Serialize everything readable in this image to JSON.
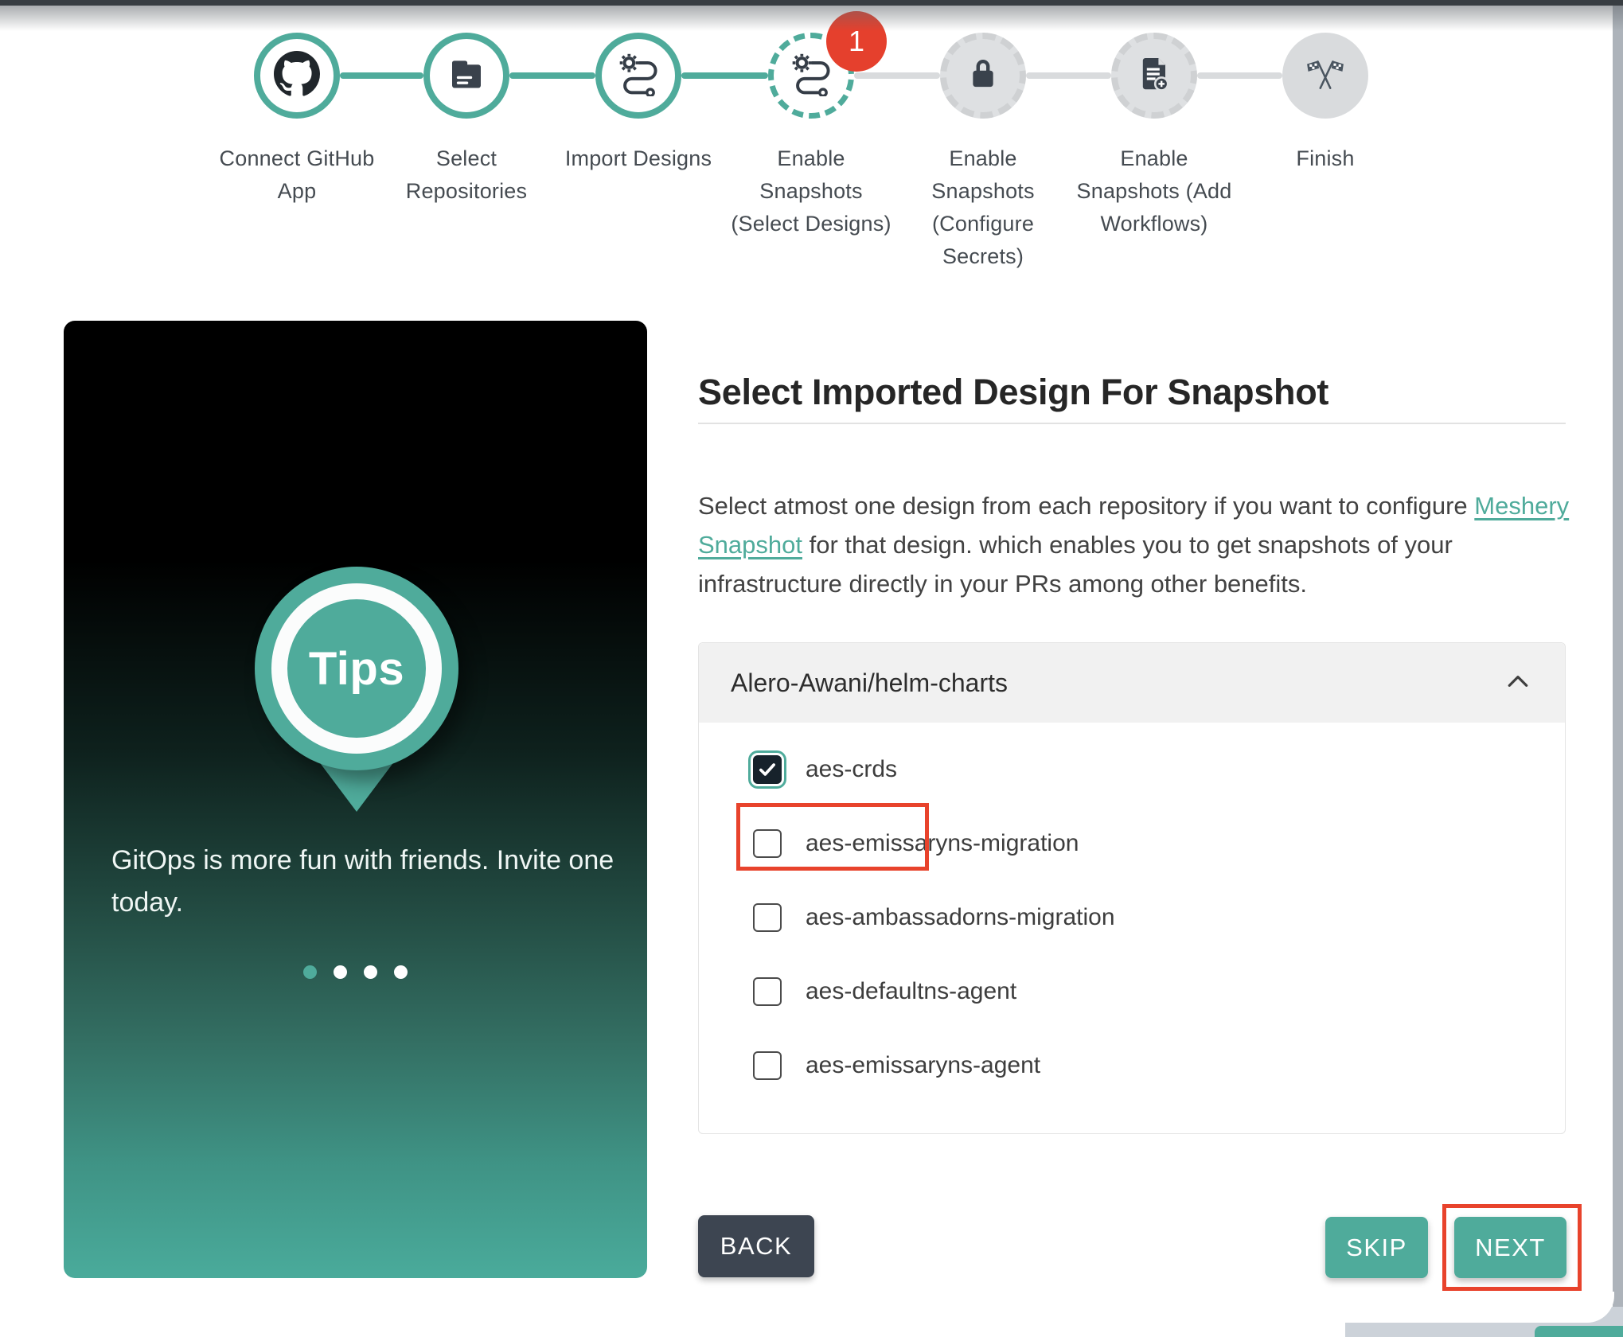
{
  "theme": {
    "teal": "#4FAB9B",
    "dark_button": "#3D4551",
    "highlight_red": "#E8432C",
    "badge_red": "#E5402D",
    "accordion_header_bg": "#F1F1F1",
    "panel_gradient_top": "#000000",
    "panel_gradient_bottom": "#4AAB9B"
  },
  "stepper": {
    "steps": [
      {
        "label": "Connect GitHub App",
        "icon": "github-icon",
        "state": "completed"
      },
      {
        "label": "Select Repositories",
        "icon": "folder-icon",
        "state": "completed"
      },
      {
        "label": "Import Designs",
        "icon": "route-icon",
        "state": "completed"
      },
      {
        "label": "Enable Snapshots (Select Designs)",
        "icon": "route-icon",
        "state": "active",
        "badge": "1"
      },
      {
        "label": "Enable Snapshots (Configure Secrets)",
        "icon": "lock-icon",
        "state": "upcoming"
      },
      {
        "label": "Enable Snapshots (Add Workflows)",
        "icon": "document-add-icon",
        "state": "upcoming"
      },
      {
        "label": "Finish",
        "icon": "finish-flags-icon",
        "state": "upcoming"
      }
    ]
  },
  "tips_panel": {
    "badge_text": "Tips",
    "message_lines": [
      "GitOps is more fun with friends. Invite one",
      "today."
    ],
    "carousel_dots": {
      "count": 4,
      "active_index": 0
    }
  },
  "main": {
    "title": "Select Imported Design For Snapshot",
    "description_before_link": "Select atmost one design from each repository if you want to configure ",
    "link_text": "Meshery Snapshot",
    "description_after_link": " for that design. which enables you to get snapshots of your infrastructure directly in your PRs among other benefits.",
    "repo_accordion": {
      "title": "Alero-Awani/helm-charts",
      "expanded": true,
      "designs": [
        {
          "label": "aes-crds",
          "checked": true,
          "highlighted": true
        },
        {
          "label": "aes-emissaryns-migration",
          "checked": false
        },
        {
          "label": "aes-ambassadorns-migration",
          "checked": false
        },
        {
          "label": "aes-defaultns-agent",
          "checked": false
        },
        {
          "label": "aes-emissaryns-agent",
          "checked": false
        }
      ]
    },
    "buttons": {
      "back": "BACK",
      "skip": "SKIP",
      "next": "NEXT"
    }
  }
}
